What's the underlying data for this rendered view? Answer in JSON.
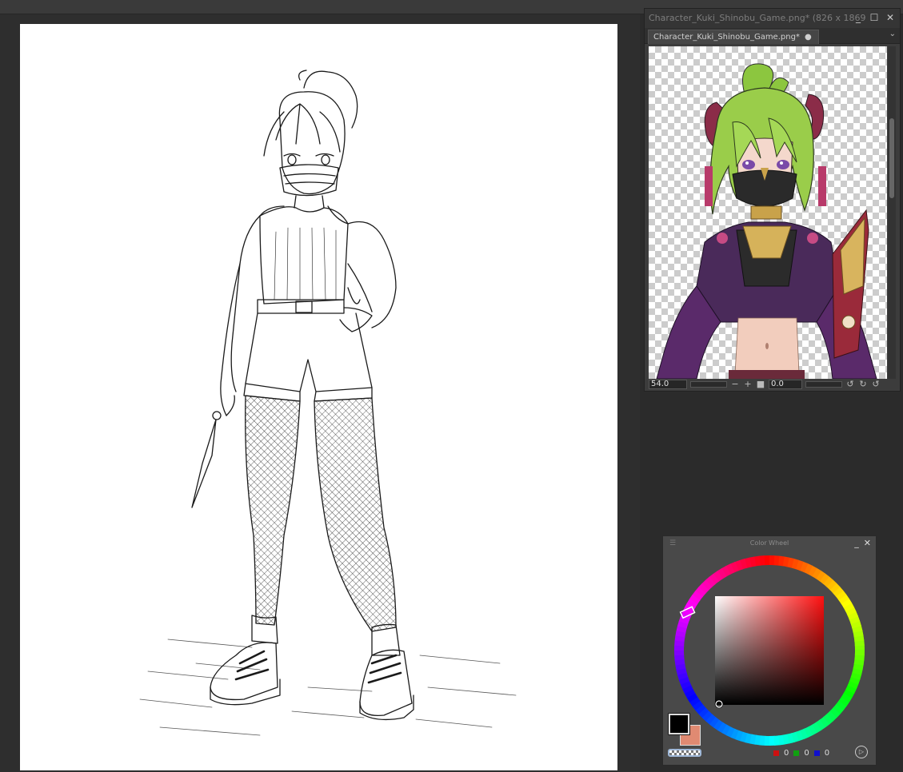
{
  "reference_window": {
    "title": "Character_Kuki_Shinobu_Game.png* (826 x 1869",
    "tab_label": "Character_Kuki_Shinobu_Game.png*",
    "tab_dot": "●",
    "zoom_value": "54.0",
    "rotation_value": "0.0",
    "minimize_icon": "minimize-icon",
    "maximize_icon": "maximize-icon",
    "close_icon": "close-icon"
  },
  "color_wheel": {
    "title": "Color Wheel",
    "foreground_color": "#000000",
    "background_color": "#e08a72",
    "rgb": {
      "r": "0",
      "g": "0",
      "b": "0"
    },
    "hue_marker_color": "#ff3030"
  }
}
